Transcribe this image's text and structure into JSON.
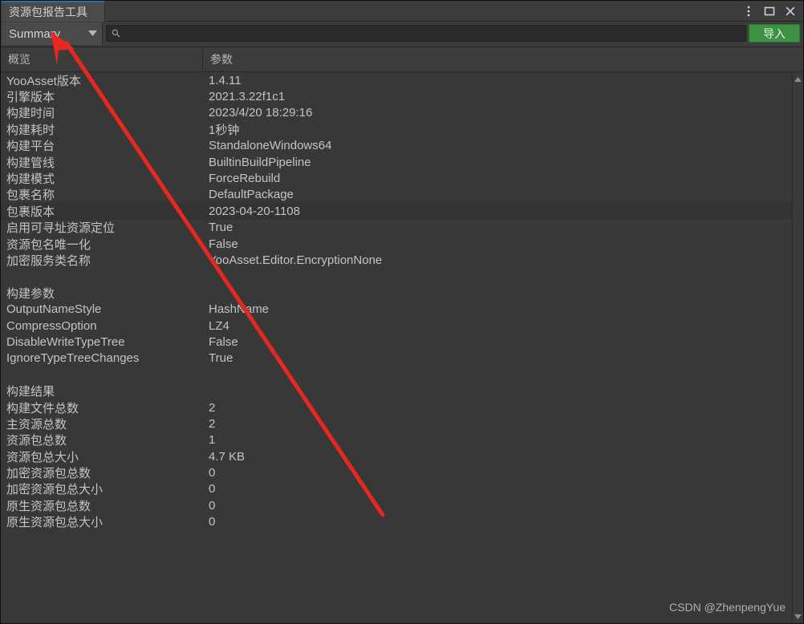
{
  "window": {
    "tab_label": "资源包报告工具",
    "controls": [
      {
        "name": "kebab-menu-icon",
        "label": "⋮"
      },
      {
        "name": "maximize-icon",
        "label": "□"
      },
      {
        "name": "close-icon",
        "label": "✕"
      }
    ]
  },
  "toolbar": {
    "dropdown_value": "Summary",
    "dropdown_arrow": "▼",
    "search_value": "",
    "search_placeholder": "",
    "import_label": "导入"
  },
  "table": {
    "columns": [
      "概览",
      "参数"
    ],
    "rows": [
      {
        "key": "YooAsset版本",
        "value": "1.4.11"
      },
      {
        "key": "引擎版本",
        "value": "2021.3.22f1c1"
      },
      {
        "key": "构建时间",
        "value": "2023/4/20 18:29:16"
      },
      {
        "key": "构建耗时",
        "value": "1秒钟"
      },
      {
        "key": "构建平台",
        "value": "StandaloneWindows64"
      },
      {
        "key": "构建管线",
        "value": "BuiltinBuildPipeline"
      },
      {
        "key": "构建模式",
        "value": "ForceRebuild"
      },
      {
        "key": "包裹名称",
        "value": "DefaultPackage"
      },
      {
        "key": "包裹版本",
        "value": "2023-04-20-1108",
        "alt": true
      },
      {
        "key": "启用可寻址资源定位",
        "value": "True"
      },
      {
        "key": "资源包名唯一化",
        "value": "False"
      },
      {
        "key": "加密服务类名称",
        "value": "YooAsset.Editor.EncryptionNone"
      },
      {
        "key": "",
        "value": ""
      },
      {
        "key": "构建参数",
        "value": ""
      },
      {
        "key": "OutputNameStyle",
        "value": "HashName"
      },
      {
        "key": "CompressOption",
        "value": "LZ4"
      },
      {
        "key": "DisableWriteTypeTree",
        "value": "False"
      },
      {
        "key": "IgnoreTypeTreeChanges",
        "value": "True"
      },
      {
        "key": "",
        "value": ""
      },
      {
        "key": "构建结果",
        "value": ""
      },
      {
        "key": "构建文件总数",
        "value": "2"
      },
      {
        "key": "主资源总数",
        "value": "2"
      },
      {
        "key": "资源包总数",
        "value": "1"
      },
      {
        "key": "资源包总大小",
        "value": "4.7 KB"
      },
      {
        "key": "加密资源包总数",
        "value": "0"
      },
      {
        "key": "加密资源包总大小",
        "value": "0"
      },
      {
        "key": "原生资源包总数",
        "value": "0"
      },
      {
        "key": "原生资源包总大小",
        "value": "0"
      }
    ]
  },
  "scrollbar": {
    "up_arrow": "▲",
    "down_arrow": "▼"
  },
  "watermark": {
    "text": "CSDN @ZhenpengYue"
  },
  "colors": {
    "accent_green": "#3c9142",
    "tab_active_border": "#2c6ea8",
    "annotation_red": "#e8271f",
    "panel_bg": "#383838",
    "toolbar_bg": "#3c3c3c"
  }
}
